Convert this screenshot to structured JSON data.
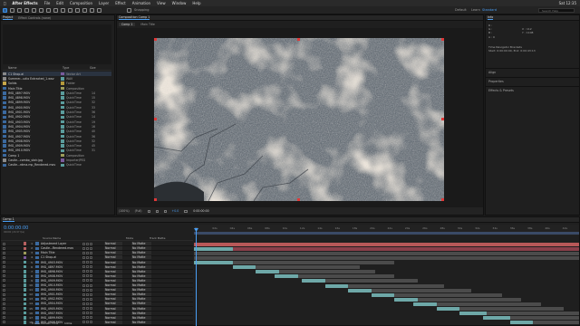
{
  "menu": [
    "After Effects",
    "File",
    "Edit",
    "Composition",
    "Layer",
    "Effect",
    "Animation",
    "View",
    "Window",
    "Help"
  ],
  "menu_right": "Sat 12:35",
  "toolbar": {
    "snapping": "Snapping",
    "workspaces": [
      "Default",
      "Learn",
      "Standard"
    ],
    "active_workspace": "Standard",
    "search_placeholder": "Search Help"
  },
  "project_panel": {
    "tab": "Project",
    "tab2": "Effect Controls (none)",
    "columns": {
      "name": "Name",
      "type": "Type",
      "size": "Size"
    },
    "items": [
      {
        "name": "C1 Shop.ai",
        "type": "Vector Art",
        "size": "",
        "color": "#7a5a9c",
        "icon": "#8a8a8a"
      },
      {
        "name": "Summer...udio Extracted_1.wav",
        "type": "WAV",
        "size": "",
        "color": "#5a9c9c",
        "icon": "#8a8a8a"
      },
      {
        "name": "Solids",
        "type": "Folder",
        "size": "",
        "color": "#b59a3b",
        "icon": "#c9a94a"
      },
      {
        "name": "Main Title",
        "type": "Composition",
        "size": "",
        "color": "#9c9c5a",
        "icon": "#3b6aa0"
      },
      {
        "name": "IMG_4897.MOV",
        "type": "QuickTime",
        "size": "14",
        "color": "#5a9c9c",
        "icon": "#3b6aa0"
      },
      {
        "name": "IMG_4898.MOV",
        "type": "QuickTime",
        "size": "15",
        "color": "#5a9c9c",
        "icon": "#3b6aa0"
      },
      {
        "name": "IMG_4899.MOV",
        "type": "QuickTime",
        "size": "32",
        "color": "#5a9c9c",
        "icon": "#3b6aa0"
      },
      {
        "name": "IMG_4900.MOV",
        "type": "QuickTime",
        "size": "33",
        "color": "#5a9c9c",
        "icon": "#3b6aa0"
      },
      {
        "name": "IMG_4901.MOV",
        "type": "QuickTime",
        "size": "36",
        "color": "#5a9c9c",
        "icon": "#3b6aa0"
      },
      {
        "name": "IMG_4902.MOV",
        "type": "QuickTime",
        "size": "14",
        "color": "#5a9c9c",
        "icon": "#3b6aa0"
      },
      {
        "name": "IMG_4903.MOV",
        "type": "QuickTime",
        "size": "19",
        "color": "#5a9c9c",
        "icon": "#3b6aa0"
      },
      {
        "name": "IMG_4904.MOV",
        "type": "QuickTime",
        "size": "16",
        "color": "#5a9c9c",
        "icon": "#3b6aa0"
      },
      {
        "name": "IMG_4905.MOV",
        "type": "QuickTime",
        "size": "40",
        "color": "#5a9c9c",
        "icon": "#3b6aa0"
      },
      {
        "name": "IMG_4907.MOV",
        "type": "QuickTime",
        "size": "36",
        "color": "#5a9c9c",
        "icon": "#3b6aa0"
      },
      {
        "name": "IMG_4908.MOV",
        "type": "QuickTime",
        "size": "32",
        "color": "#5a9c9c",
        "icon": "#3b6aa0"
      },
      {
        "name": "IMG_4909.MOV",
        "type": "QuickTime",
        "size": "45",
        "color": "#5a9c9c",
        "icon": "#3b6aa0"
      },
      {
        "name": "IMG_4910.MOV",
        "type": "QuickTime",
        "size": "31",
        "color": "#5a9c9c",
        "icon": "#3b6aa0"
      },
      {
        "name": "Comp 1",
        "type": "Composition",
        "size": "",
        "color": "#9c9c5a",
        "icon": "#3b6aa0"
      },
      {
        "name": "Castle...combo_stair.jpg",
        "type": "ImporterJPEG",
        "size": "",
        "color": "#7a5a9c",
        "icon": "#8a8a8a"
      },
      {
        "name": "Castle...rdma.mp_Rendered.mov",
        "type": "QuickTime",
        "size": "",
        "color": "#5a9c9c",
        "icon": "#3b6aa0"
      }
    ]
  },
  "viewer": {
    "tab": "Composition Comp 1",
    "subtabs": [
      "Comp 1",
      "Main Title"
    ],
    "zoom": "(100%)",
    "quality": "(Full)",
    "timecode": "0:00:00:00",
    "exposure": "+0.0"
  },
  "info_panel": {
    "title": "Info",
    "rgb": [
      "R :",
      "G :",
      "B :",
      "A : 0"
    ],
    "xy": [
      "X : 112",
      "Y : 1108"
    ],
    "lines": [
      "Time Navigator Brackets",
      "Start: 0:00:00:00, End: 0:00:43:13"
    ],
    "sections": [
      "Align",
      "Properties",
      "Effects & Presets"
    ]
  },
  "timeline": {
    "tab": "Comp 1",
    "timecode": "0:00:00:00",
    "fps": "00000 (29.97 fps)",
    "header": {
      "source": "Source Name",
      "mode": "Mode",
      "trkmat": "Track Matte"
    },
    "ruler": [
      "0s",
      "02s",
      "04s",
      "06s",
      "08s",
      "10s",
      "12s",
      "14s",
      "16s",
      "18s",
      "20s",
      "22s",
      "24s",
      "26s",
      "28s",
      "30s",
      "32s",
      "34s",
      "36s",
      "38s",
      "40s",
      "42s"
    ],
    "footer": {
      "label": "Frame Render Time",
      "value": "14ms"
    },
    "layers": [
      {
        "num": "1",
        "name": "Adjustment Layer",
        "mode": "Normal",
        "matte": "No Matte",
        "color": "#b56060",
        "bar": [
          0.0,
          1.0
        ],
        "bar_color": "#b85858"
      },
      {
        "num": "2",
        "name": "Castle...Rendered.mov",
        "mode": "Normal",
        "matte": "No Matte",
        "color": "#b56060",
        "bar": [
          0.0,
          0.1
        ],
        "bar_color": "#6ea8a8",
        "bar2": [
          0.0,
          1.0
        ],
        "bar2_color": "#8a3f4a"
      },
      {
        "num": "3",
        "name": "Main Title",
        "mode": "Normal",
        "matte": "No Matte",
        "color": "#9c9c5a",
        "bar": [
          0.0,
          1.0
        ],
        "bar_color": "#4b4b4b"
      },
      {
        "num": "4",
        "name": "C1 Shop.ai",
        "mode": "Normal",
        "matte": "No Matte",
        "color": "#7a5a9c",
        "bar": [
          0.0,
          1.0
        ],
        "bar_color": "#4b4b4b",
        "bar2": [
          0.87,
          1.0
        ],
        "bar2_color": "#8a86b8"
      },
      {
        "num": "5",
        "name": "IMG_4903.MOV",
        "mode": "Normal",
        "matte": "No Matte",
        "color": "#5a9c9c",
        "bar": [
          0.0,
          0.1
        ],
        "bar_color": "#6ea8a8",
        "bar2": [
          0.1,
          0.52
        ],
        "bar2_color": "#4b4b4b"
      },
      {
        "num": "6",
        "name": "IMG_4897.MOV",
        "mode": "Normal",
        "matte": "No Matte",
        "color": "#5a9c9c",
        "bar": [
          0.1,
          0.16
        ],
        "bar_color": "#6ea8a8",
        "bar2": [
          0.16,
          0.43
        ],
        "bar2_color": "#4b4b4b"
      },
      {
        "num": "7",
        "name": "IMG_4898.MOV",
        "mode": "Normal",
        "matte": "No Matte",
        "color": "#5a9c9c",
        "bar": [
          0.16,
          0.22
        ],
        "bar_color": "#6ea8a8",
        "bar2": [
          0.22,
          0.47
        ],
        "bar2_color": "#4b4b4b"
      },
      {
        "num": "8",
        "name": "IMG_4908.MOV",
        "mode": "Normal",
        "matte": "No Matte",
        "color": "#5a9c9c",
        "bar": [
          0.21,
          0.27
        ],
        "bar_color": "#6ea8a8",
        "bar2": [
          0.27,
          0.52
        ],
        "bar2_color": "#4b4b4b"
      },
      {
        "num": "9",
        "name": "IMG_4909.MOV",
        "mode": "Normal",
        "matte": "No Matte",
        "color": "#5a9c9c",
        "bar": [
          0.28,
          0.34
        ],
        "bar_color": "#6ea8a8",
        "bar2": [
          0.34,
          0.58
        ],
        "bar2_color": "#4b4b4b"
      },
      {
        "num": "10",
        "name": "IMG_4910.MOV",
        "mode": "Normal",
        "matte": "No Matte",
        "color": "#5a9c9c",
        "bar": [
          0.34,
          0.4
        ],
        "bar_color": "#6ea8a8",
        "bar2": [
          0.4,
          0.65
        ],
        "bar2_color": "#4b4b4b"
      },
      {
        "num": "11",
        "name": "IMG_4900.MOV",
        "mode": "Normal",
        "matte": "No Matte",
        "color": "#5a9c9c",
        "bar": [
          0.4,
          0.46
        ],
        "bar_color": "#6ea8a8",
        "bar2": [
          0.46,
          0.72
        ],
        "bar2_color": "#4b4b4b"
      },
      {
        "num": "12",
        "name": "IMG_4901.MOV",
        "mode": "Normal",
        "matte": "No Matte",
        "color": "#5a9c9c",
        "bar": [
          0.46,
          0.52
        ],
        "bar_color": "#6ea8a8",
        "bar2": [
          0.52,
          0.8
        ],
        "bar2_color": "#4b4b4b"
      },
      {
        "num": "13",
        "name": "IMG_4902.MOV",
        "mode": "Normal",
        "matte": "No Matte",
        "color": "#5a9c9c",
        "bar": [
          0.52,
          0.58
        ],
        "bar_color": "#6ea8a8",
        "bar2": [
          0.58,
          0.85
        ],
        "bar2_color": "#4b4b4b"
      },
      {
        "num": "14",
        "name": "IMG_4904.MOV",
        "mode": "Normal",
        "matte": "No Matte",
        "color": "#5a9c9c",
        "bar": [
          0.57,
          0.63
        ],
        "bar_color": "#6ea8a8",
        "bar2": [
          0.63,
          0.9
        ],
        "bar2_color": "#4b4b4b"
      },
      {
        "num": "15",
        "name": "IMG_4905.MOV",
        "mode": "Normal",
        "matte": "No Matte",
        "color": "#5a9c9c",
        "bar": [
          0.63,
          0.69
        ],
        "bar_color": "#6ea8a8",
        "bar2": [
          0.69,
          0.96
        ],
        "bar2_color": "#4b4b4b"
      },
      {
        "num": "16",
        "name": "IMG_4907.MOV",
        "mode": "Normal",
        "matte": "No Matte",
        "color": "#5a9c9c",
        "bar": [
          0.69,
          0.76
        ],
        "bar_color": "#6ea8a8",
        "bar2": [
          0.76,
          1.0
        ],
        "bar2_color": "#4b4b4b"
      },
      {
        "num": "17",
        "name": "IMG_4899.MOV",
        "mode": "Normal",
        "matte": "No Matte",
        "color": "#5a9c9c",
        "bar": [
          0.75,
          0.82
        ],
        "bar_color": "#6ea8a8",
        "bar2": [
          0.82,
          1.0
        ],
        "bar2_color": "#4b4b4b"
      },
      {
        "num": "18",
        "name": "IMG_4906.MOV",
        "mode": "Normal",
        "matte": "No Matte",
        "color": "#5a9c9c",
        "bar": [
          0.82,
          0.88
        ],
        "bar_color": "#6ea8a8",
        "bar2": [
          0.88,
          1.0
        ],
        "bar2_color": "#4b4b4b"
      }
    ]
  },
  "colors": {
    "accent": "#4a9ff5",
    "handle": "#e03838",
    "timeline_work_area": "#3a4a66"
  }
}
